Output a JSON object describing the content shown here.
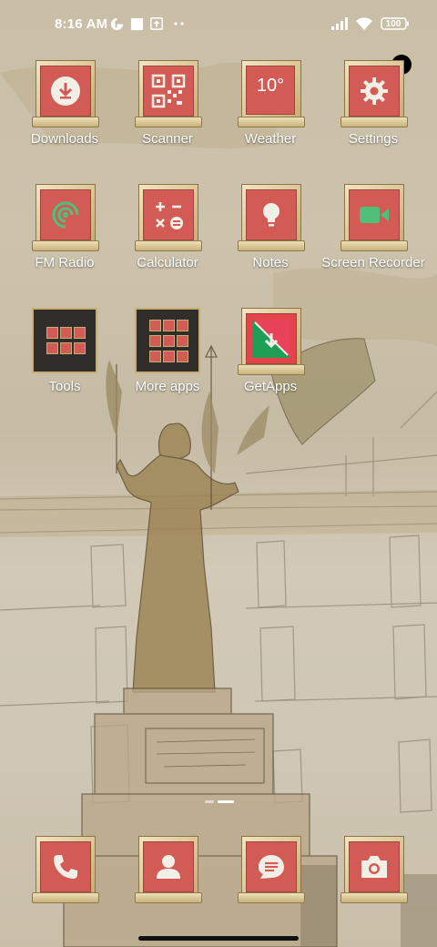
{
  "status_bar": {
    "time": "8:16 AM",
    "battery": "100",
    "icons": [
      "data-saver-icon",
      "square-notification-icon",
      "upload-notification-icon",
      "more-dots-icon",
      "signal-icon",
      "wifi-icon",
      "battery-icon"
    ]
  },
  "apps": [
    {
      "label": "Downloads",
      "icon": "download-icon"
    },
    {
      "label": "Scanner",
      "icon": "qr-code-icon"
    },
    {
      "label": "Weather",
      "icon": "weather-icon",
      "temp": "10°"
    },
    {
      "label": "Settings",
      "icon": "gear-icon"
    },
    {
      "label": "FM Radio",
      "icon": "radio-icon"
    },
    {
      "label": "Calculator",
      "icon": "calculator-icon"
    },
    {
      "label": "Notes",
      "icon": "lightbulb-icon"
    },
    {
      "label": "Screen Recorder",
      "icon": "video-camera-icon"
    },
    {
      "label": "Tools",
      "icon": "folder-icon"
    },
    {
      "label": "More apps",
      "icon": "folder-icon"
    },
    {
      "label": "GetApps",
      "icon": "getapps-icon"
    }
  ],
  "dock": [
    {
      "name": "Phone",
      "icon": "phone-icon"
    },
    {
      "name": "Contacts",
      "icon": "contact-icon"
    },
    {
      "name": "Messages",
      "icon": "message-icon"
    },
    {
      "name": "Camera",
      "icon": "camera-icon"
    }
  ],
  "pager": {
    "pages": 2,
    "current": 2
  },
  "colors": {
    "tile": "#d25c55",
    "frame": "#e3d3a6",
    "icon_glyph": "#f2f0e6"
  }
}
